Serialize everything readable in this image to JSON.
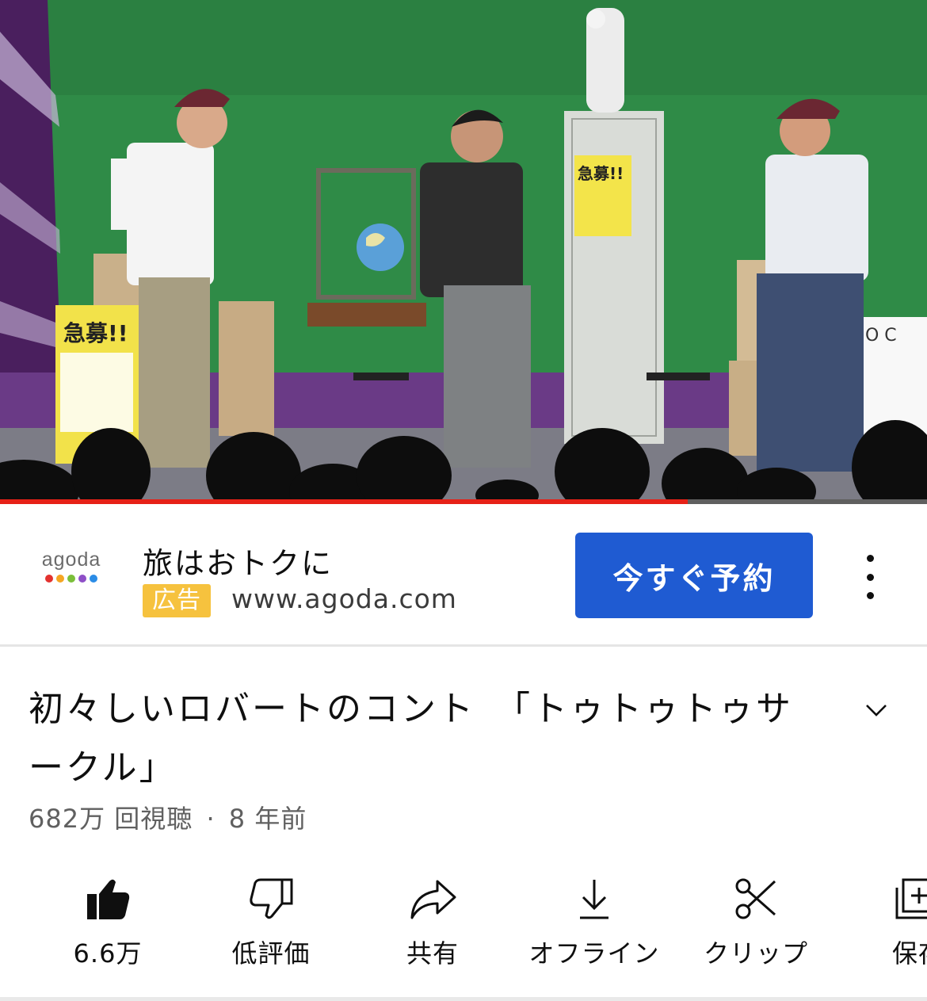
{
  "video": {
    "progress_fraction": 0.742,
    "poster_text": "急募!!"
  },
  "ad": {
    "logo_text": "agoda",
    "logo_dot_colors": [
      "#e3322f",
      "#f5a623",
      "#7bbf3a",
      "#8e4fc7",
      "#2b8ce6"
    ],
    "headline": "旅はおトクに",
    "badge": "広告",
    "url": "www.agoda.com",
    "cta_label": "今すぐ予約"
  },
  "video_info": {
    "title": "初々しいロバートのコント　「トゥトゥトゥサークル」",
    "views": "682万 回視聴",
    "separator": "·",
    "age": "8 年前"
  },
  "actions": [
    {
      "id": "like",
      "label": "6.6万",
      "icon": "thumbs-up-icon"
    },
    {
      "id": "dislike",
      "label": "低評価",
      "icon": "thumbs-down-icon"
    },
    {
      "id": "share",
      "label": "共有",
      "icon": "share-icon"
    },
    {
      "id": "download",
      "label": "オフライン",
      "icon": "download-icon"
    },
    {
      "id": "clip",
      "label": "クリップ",
      "icon": "scissors-icon"
    },
    {
      "id": "save",
      "label": "保存",
      "icon": "add-to-playlist-icon"
    }
  ],
  "colors": {
    "progress_played": "#e62117",
    "cta_background": "#1f5bd2",
    "ad_badge": "#f6c23e"
  }
}
